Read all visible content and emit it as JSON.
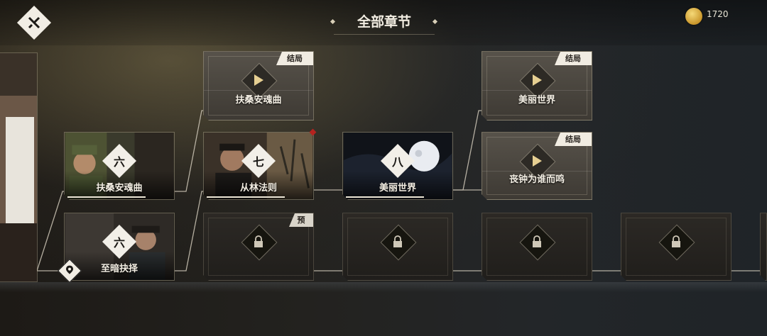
{
  "header": {
    "title": "全部章节",
    "coins": "1720"
  },
  "icons": {
    "back": "close-x-icon",
    "coin": "gold-coin-icon",
    "play": "play-icon",
    "lock": "lock-icon",
    "location": "location-pin-icon"
  },
  "tags": {
    "ending": "结局",
    "preview": "预"
  },
  "chapters": {
    "six_a": {
      "number": "六",
      "title": "扶桑安魂曲"
    },
    "six_b": {
      "number": "六",
      "title": "至暗抉择"
    },
    "seven": {
      "number": "七",
      "title": "从林法则"
    },
    "eight": {
      "number": "八",
      "title": "美丽世界"
    }
  },
  "endings": {
    "e1": "扶桑安魂曲",
    "e2": "美丽世界",
    "e3": "丧钟为谁而鸣"
  },
  "colors": {
    "accent_red": "#b5231f",
    "coin_gold": "#d9a93a",
    "tag_bg": "#f1ece2"
  }
}
